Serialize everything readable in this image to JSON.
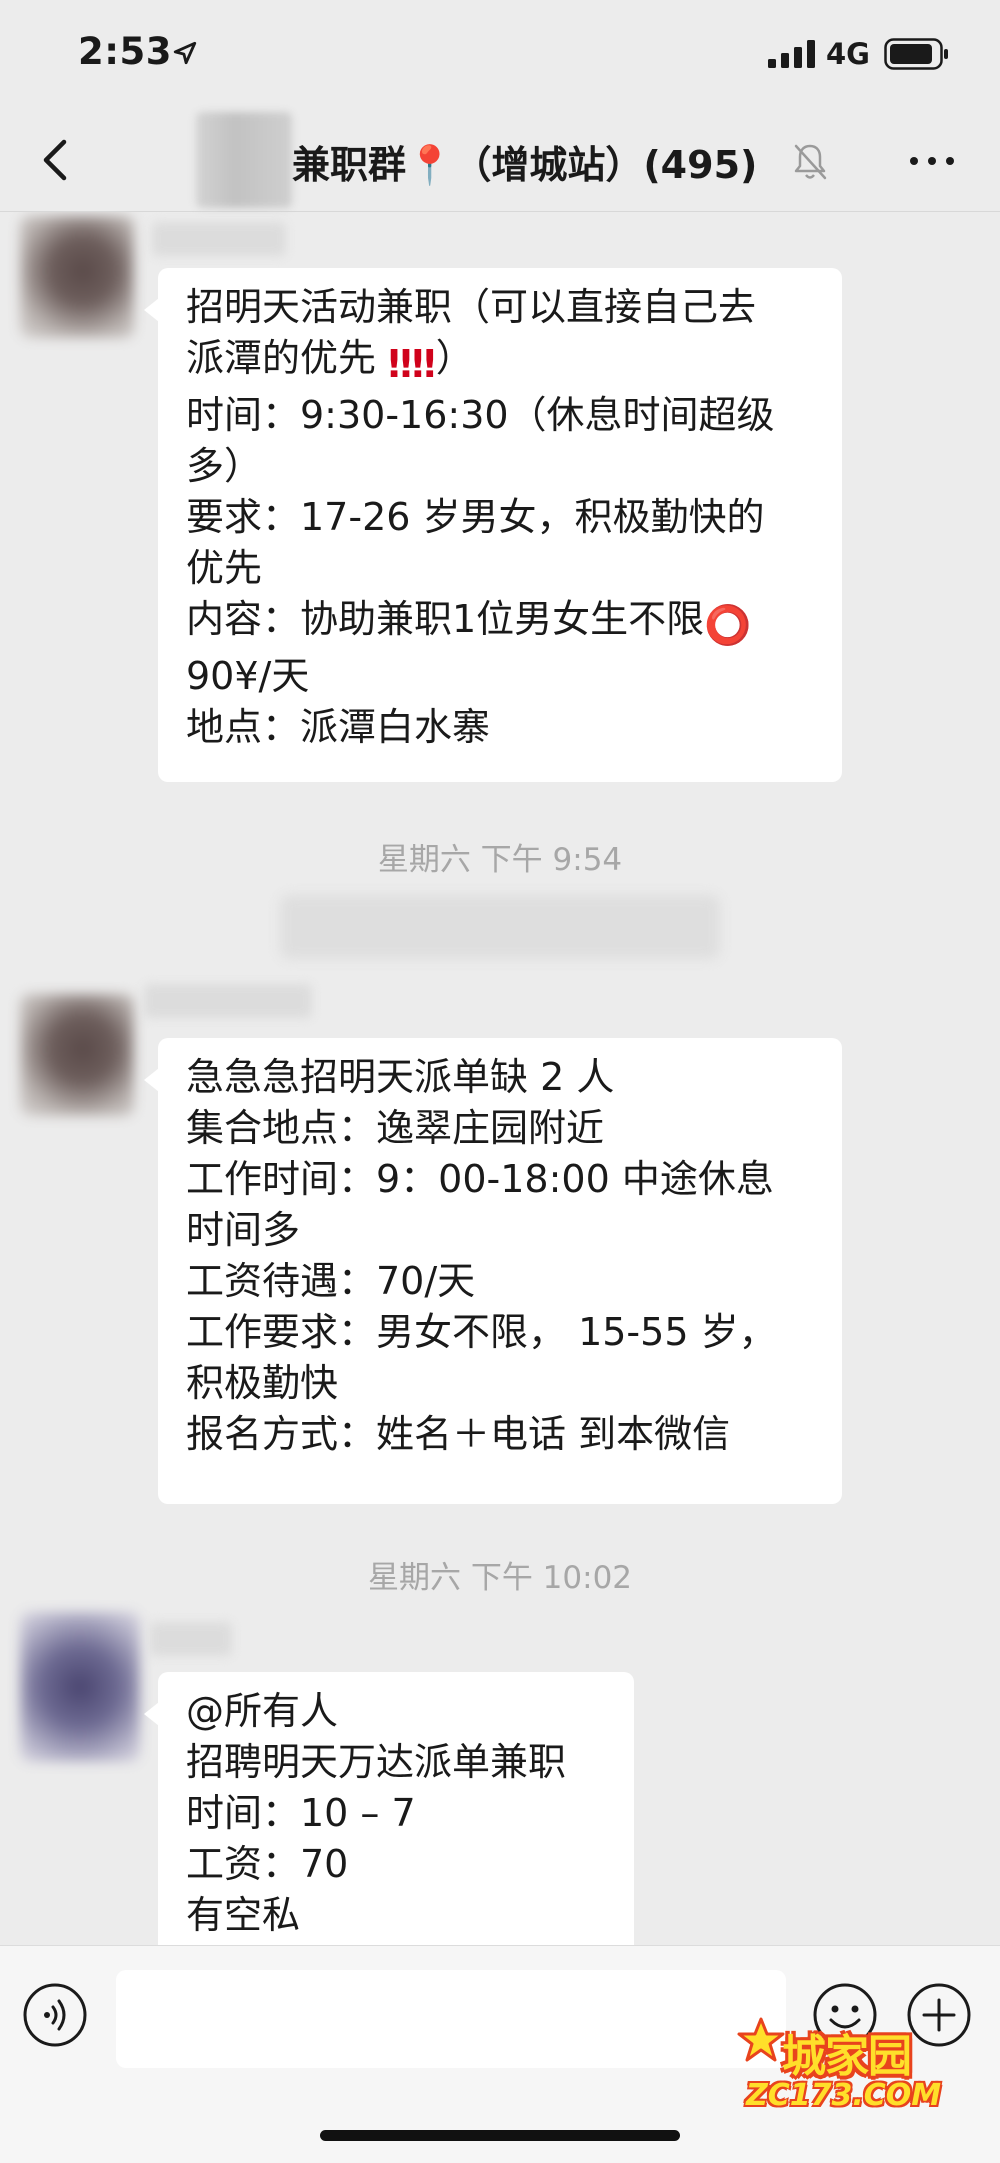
{
  "status_bar": {
    "time": "2:53",
    "network": "4G"
  },
  "header": {
    "title": "兼职群📍（增城站）(495)",
    "icons": [
      "back-icon",
      "map-pin-icon",
      "mute-bell-icon",
      "more-icon"
    ]
  },
  "chat": {
    "messages": [
      {
        "lines": [
          "招明天活动兼职（可以直接自己去",
          "派潭的优先 ‼️‼️）",
          "时间：9:30-16:30（休息时间超级",
          "多）",
          "要求：17-26 岁男女，积极勤快的",
          "优先",
          "内容：协助兼职1位男女生不限⭕",
          "90¥/天",
          "地点：派潭白水寨"
        ]
      },
      {
        "lines": [
          "急急急招明天派单缺 2 人",
          "集合地点：逸翠庄园附近",
          "工作时间：9：00-18:00 中途休息",
          "时间多",
          "工资待遇：70/天",
          "工作要求：男女不限， 15-55 岁，",
          "积极勤快",
          "报名方式：姓名＋电话 到本微信"
        ]
      },
      {
        "lines": [
          "@所有人",
          "招聘明天万达派单兼职",
          "时间：10 – 7",
          "工资：70",
          "有空私"
        ]
      }
    ],
    "timestamps": [
      "星期六 下午 9:54",
      "星期六 下午 10:02"
    ]
  },
  "input_bar": {
    "placeholder": "",
    "icons": [
      "voice-icon",
      "emoji-icon",
      "plus-icon"
    ]
  },
  "watermark": {
    "line1": "城家园",
    "line2": "ZC173.COM"
  },
  "colors": {
    "background": "#ececec",
    "bubble": "#ffffff",
    "timestamp": "#a7a7a7",
    "exclamation": "#d0021b",
    "circle": "#e0243a"
  }
}
